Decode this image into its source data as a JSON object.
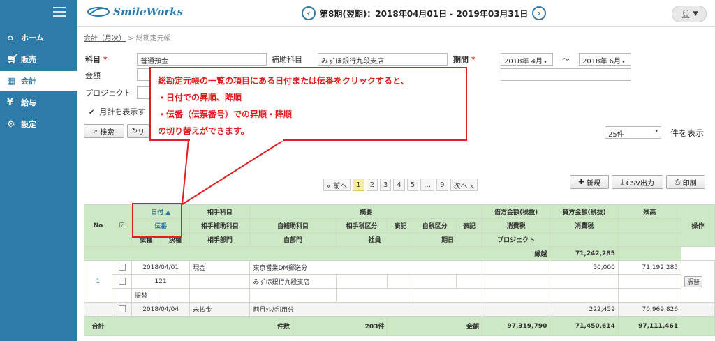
{
  "app": {
    "logo": "SmileWorks"
  },
  "sidebar": {
    "items": [
      {
        "label": "ホーム",
        "icon": "home-icon"
      },
      {
        "label": "販売",
        "icon": "cart-icon"
      },
      {
        "label": "会計",
        "icon": "calculator-icon"
      },
      {
        "label": "給与",
        "icon": "money-bag-icon"
      },
      {
        "label": "設定",
        "icon": "gear-icon"
      }
    ]
  },
  "header": {
    "period": "第8期(翌期)：2018年04月01日 - 2019年03月31日",
    "prev": "‹",
    "next": "›"
  },
  "breadcrumb": {
    "parent": "会計（月次）",
    "sep": ">",
    "current": "総勘定元帳"
  },
  "form": {
    "kamoku_label": "科目",
    "kamoku_value": "普通預金",
    "hojo_label": "補助科目",
    "hojo_value": "みずほ銀行九段支店",
    "kikan_label": "期間",
    "from": "2018年 4月",
    "tilde": "～",
    "to": "2018年 6月",
    "kingaku_label": "金額",
    "project_label": "プロジェクト",
    "monthly_label": "月計を表示す",
    "search_btn": "検索",
    "reset_btn": "リ",
    "perpage": "25件",
    "perpage_suffix": "件を表示"
  },
  "callout": {
    "line1": "総勘定元帳の一覧の項目にある日付または伝番をクリックすると、",
    "line2": "・日付での昇順、降順",
    "line3": "・伝番（伝票番号）での昇順・降順",
    "line4": "の切り替えができます。"
  },
  "pager": {
    "prev": "« 前へ",
    "pages": [
      "1",
      "2",
      "3",
      "4",
      "5",
      "…",
      "9"
    ],
    "next": "次へ »"
  },
  "actions": {
    "new": "新規",
    "csv": "CSV出力",
    "print": "印刷"
  },
  "table": {
    "h_no": "No",
    "h_date": "日付 ▲",
    "h_denban": "伝番",
    "h_denshu": "伝種",
    "h_kessan": "決種",
    "h_aite": "相手科目",
    "h_aite_hojo": "相手補助科目",
    "h_aite_bumon": "相手部門",
    "h_tekiyo": "摘要",
    "h_jihojo": "自補助科目",
    "h_aite_zei": "相手税区分",
    "h_hyoki1": "表記",
    "h_jizei": "自税区分",
    "h_hyoki2": "表記",
    "h_jibumon": "自部門",
    "h_shain": "社員",
    "h_kijitsu": "期日",
    "h_kari": "借方金額(税抜)",
    "h_kashi": "貸方金額(税抜)",
    "h_zandaka": "残高",
    "h_shohi1": "消費税",
    "h_shohi2": "消費税",
    "h_project": "プロジェクト",
    "h_sousa": "操作",
    "kurikoshi_label": "繰越",
    "kurikoshi_value": "71,242,285",
    "r1_no": "1",
    "r1_date": "2018/04/01",
    "r1_aite": "現金",
    "r1_tekiyo": "東京営業DM郵送分",
    "r1_kashi": "50,000",
    "r1_zandaka": "71,192,285",
    "r1_denban": "121",
    "r1_jihojo": "みずほ銀行九段支店",
    "r1_denshu": "振替",
    "r1_op": "振替",
    "r2_date": "2018/04/04",
    "r2_aite": "未払金",
    "r2_tekiyo": "前月ｸﾚｶ利用分",
    "r2_kashi": "222,459",
    "r2_zandaka": "70,969,826",
    "t_label": "合計",
    "t_kensu_label": "件数",
    "t_kensu": "203件",
    "t_kingaku_label": "金額",
    "t_kingaku": "97,319,790",
    "t_kashi": "71,450,614",
    "t_zandaka": "97,111,461"
  }
}
